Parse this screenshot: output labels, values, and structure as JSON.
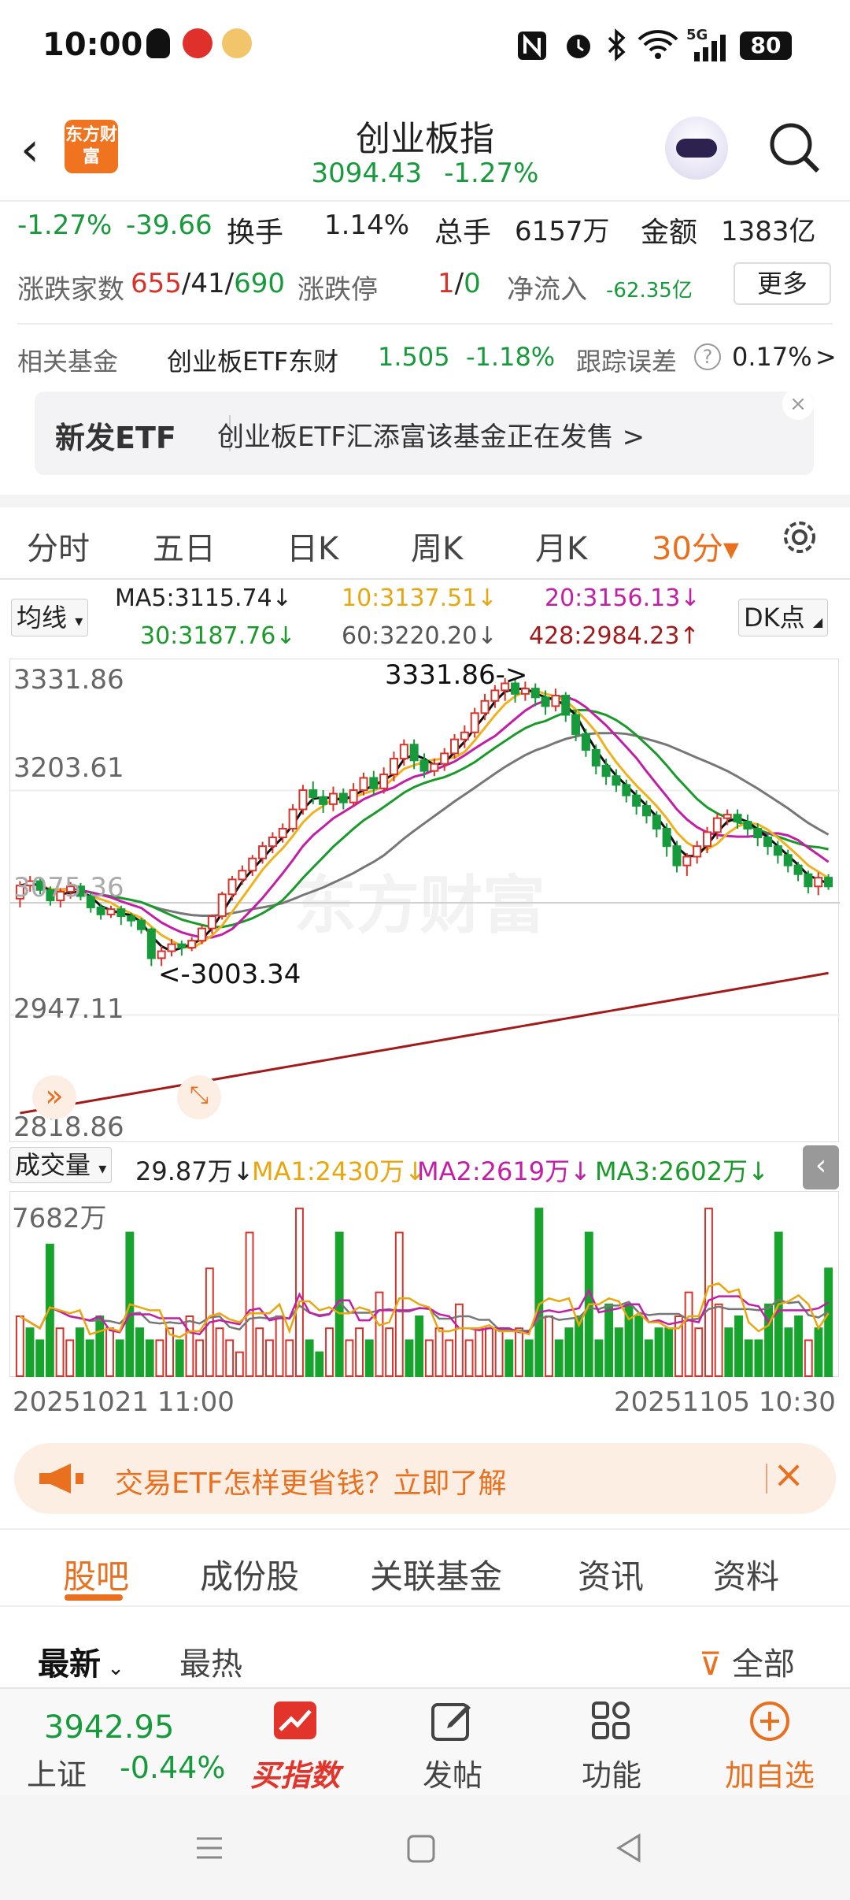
{
  "status_bar": {
    "time": "10:00",
    "battery": "80",
    "network": "5G"
  },
  "header": {
    "logo_text": "东方财富",
    "title": "创业板指",
    "price": "3094.43",
    "change_pct": "-1.27%"
  },
  "stats": {
    "pct": "-1.27%",
    "change": "-39.66",
    "turnover_label": "换手",
    "turnover": "1.14%",
    "volume_label": "总手",
    "volume": "6157万",
    "amount_label": "金额",
    "amount": "1383亿",
    "breadth_label": "涨跌家数",
    "breadth_up": "655",
    "breadth_flat": "41",
    "breadth_down": "690",
    "limit_label": "涨跌停",
    "limit_up": "1",
    "limit_down": "0",
    "netflow_label": "净流入",
    "netflow": "-62.35亿",
    "more": "更多"
  },
  "fund": {
    "label": "相关基金",
    "name": "创业板ETF东财",
    "price": "1.505",
    "pct": "-1.18%",
    "err_label": "跟踪误差",
    "err": "0.17%",
    "arrow": ">"
  },
  "banner": {
    "tag": "新发ETF",
    "text": "创业板ETF汇添富该基金正在发售  >",
    "close": "×"
  },
  "period_tabs": [
    "分时",
    "五日",
    "日K",
    "周K",
    "月K",
    "30分▾"
  ],
  "ma": {
    "selector": "均线",
    "ma5": "MA5:3115.74↓",
    "ma10": "10:3137.51↓",
    "ma20": "20:3156.13↓",
    "ma30": "30:3187.76↓",
    "ma60": "60:3220.20↓",
    "ma428": "428:2984.23↑",
    "dk": "DK点"
  },
  "price_axis": [
    "3331.86",
    "3203.61",
    "3075.36",
    "2947.11",
    "2818.86"
  ],
  "annotations": {
    "high": "3331.86->",
    "low": "<-3003.34",
    "watermark": "东方财富"
  },
  "volume": {
    "selector": "成交量",
    "value": "29.87万↓",
    "ma1": "MA1:2430万↓",
    "ma2": "MA2:2619万↓",
    "ma3": "MA3:2602万↓",
    "axis_max": "7682万"
  },
  "dates": {
    "start": "20251021 11:00",
    "end": "20251105 10:30"
  },
  "notice": {
    "text": "交易ETF怎样更省钱？立即了解",
    "close": "×"
  },
  "content_tabs": [
    "股吧",
    "成份股",
    "关联基金",
    "资讯",
    "资料"
  ],
  "sort": {
    "latest": "最新",
    "hot": "最热",
    "filter": "全部"
  },
  "bottom": {
    "index_price": "3942.95",
    "index_name": "上证",
    "index_pct": "-0.44%",
    "buy": "买指数",
    "post": "发帖",
    "func": "功能",
    "add": "加自选"
  },
  "colors": {
    "up": "#d8332b",
    "down": "#179a3c",
    "accent": "#e8701e",
    "ma5": "#111111",
    "ma10": "#f0b21c",
    "ma20": "#c21ea6",
    "ma30": "#1a9a2a",
    "ma60": "#777777",
    "ma428": "#a31a1a"
  },
  "chart_data": {
    "type": "candlestick",
    "ylim": [
      2818.86,
      3331.86
    ],
    "x_start": "20251021 11:00",
    "x_end": "20251105 10:30",
    "candles": [
      [
        3080,
        3095,
        3070,
        3100
      ],
      [
        3095,
        3100,
        3088,
        3106
      ],
      [
        3100,
        3090,
        3085,
        3104
      ],
      [
        3090,
        3078,
        3072,
        3094
      ],
      [
        3078,
        3088,
        3070,
        3092
      ],
      [
        3088,
        3094,
        3080,
        3099
      ],
      [
        3094,
        3083,
        3078,
        3098
      ],
      [
        3083,
        3070,
        3064,
        3088
      ],
      [
        3070,
        3062,
        3056,
        3074
      ],
      [
        3062,
        3068,
        3058,
        3072
      ],
      [
        3068,
        3060,
        3050,
        3072
      ],
      [
        3060,
        3055,
        3048,
        3064
      ],
      [
        3055,
        3045,
        3040,
        3058
      ],
      [
        3045,
        3012,
        3003,
        3047
      ],
      [
        3012,
        3020,
        3003,
        3026
      ],
      [
        3020,
        3028,
        3014,
        3034
      ],
      [
        3028,
        3024,
        3015,
        3032
      ],
      [
        3024,
        3032,
        3020,
        3036
      ],
      [
        3032,
        3046,
        3028,
        3050
      ],
      [
        3046,
        3060,
        3040,
        3062
      ],
      [
        3060,
        3085,
        3056,
        3088
      ],
      [
        3085,
        3102,
        3078,
        3106
      ],
      [
        3102,
        3112,
        3096,
        3118
      ],
      [
        3112,
        3126,
        3106,
        3130
      ],
      [
        3126,
        3140,
        3120,
        3145
      ],
      [
        3140,
        3150,
        3132,
        3156
      ],
      [
        3150,
        3160,
        3144,
        3166
      ],
      [
        3160,
        3182,
        3156,
        3188
      ],
      [
        3182,
        3204,
        3176,
        3210
      ],
      [
        3204,
        3196,
        3188,
        3214
      ],
      [
        3196,
        3188,
        3178,
        3204
      ],
      [
        3188,
        3200,
        3180,
        3208
      ],
      [
        3200,
        3190,
        3182,
        3206
      ],
      [
        3190,
        3204,
        3186,
        3212
      ],
      [
        3204,
        3218,
        3198,
        3224
      ],
      [
        3218,
        3206,
        3198,
        3226
      ],
      [
        3206,
        3222,
        3200,
        3230
      ],
      [
        3222,
        3240,
        3214,
        3248
      ],
      [
        3240,
        3256,
        3232,
        3262
      ],
      [
        3256,
        3238,
        3228,
        3262
      ],
      [
        3238,
        3226,
        3218,
        3246
      ],
      [
        3226,
        3234,
        3220,
        3240
      ],
      [
        3234,
        3246,
        3226,
        3252
      ],
      [
        3246,
        3262,
        3240,
        3268
      ],
      [
        3262,
        3270,
        3252,
        3278
      ],
      [
        3270,
        3292,
        3264,
        3298
      ],
      [
        3292,
        3306,
        3284,
        3314
      ],
      [
        3306,
        3318,
        3298,
        3324
      ],
      [
        3318,
        3326,
        3306,
        3332
      ],
      [
        3326,
        3314,
        3304,
        3331
      ],
      [
        3314,
        3320,
        3306,
        3328
      ],
      [
        3320,
        3310,
        3300,
        3326
      ],
      [
        3310,
        3300,
        3290,
        3318
      ],
      [
        3300,
        3312,
        3294,
        3320
      ],
      [
        3312,
        3290,
        3282,
        3316
      ],
      [
        3290,
        3268,
        3260,
        3296
      ],
      [
        3268,
        3250,
        3242,
        3274
      ],
      [
        3250,
        3232,
        3222,
        3256
      ],
      [
        3232,
        3220,
        3210,
        3240
      ],
      [
        3220,
        3210,
        3202,
        3228
      ],
      [
        3210,
        3198,
        3190,
        3216
      ],
      [
        3198,
        3186,
        3176,
        3204
      ],
      [
        3186,
        3175,
        3166,
        3192
      ],
      [
        3175,
        3160,
        3150,
        3180
      ],
      [
        3160,
        3140,
        3128,
        3166
      ],
      [
        3140,
        3118,
        3110,
        3146
      ],
      [
        3118,
        3128,
        3106,
        3132
      ],
      [
        3128,
        3140,
        3120,
        3146
      ],
      [
        3140,
        3156,
        3132,
        3162
      ],
      [
        3156,
        3172,
        3148,
        3178
      ],
      [
        3172,
        3176,
        3164,
        3182
      ],
      [
        3176,
        3168,
        3160,
        3182
      ],
      [
        3168,
        3160,
        3152,
        3176
      ],
      [
        3160,
        3150,
        3140,
        3166
      ],
      [
        3150,
        3140,
        3130,
        3156
      ],
      [
        3140,
        3130,
        3120,
        3146
      ],
      [
        3130,
        3118,
        3110,
        3136
      ],
      [
        3118,
        3108,
        3100,
        3122
      ],
      [
        3108,
        3094,
        3086,
        3112
      ],
      [
        3094,
        3104,
        3084,
        3110
      ],
      [
        3104,
        3094,
        3090,
        3108
      ]
    ],
    "volumes": [
      5,
      4,
      3,
      11,
      4,
      3,
      4,
      3,
      5,
      4,
      3,
      12,
      4,
      3,
      3,
      4,
      3,
      5,
      3,
      9,
      4,
      3,
      2,
      12,
      4,
      3,
      5,
      3,
      14,
      3,
      2,
      4,
      12,
      3,
      4,
      3,
      7,
      4,
      12,
      3,
      5,
      3,
      4,
      3,
      6,
      3,
      4,
      4,
      4,
      3,
      4,
      3,
      14,
      5,
      3,
      4,
      5,
      12,
      3,
      6,
      4,
      6,
      5,
      3,
      4,
      4,
      5,
      7,
      4,
      14,
      6,
      4,
      5,
      3,
      3,
      6,
      12,
      4,
      5,
      3,
      4,
      9
    ],
    "volume_up": [
      1,
      0,
      0,
      0,
      1,
      1,
      0,
      0,
      0,
      1,
      0,
      0,
      0,
      0,
      1,
      1,
      0,
      1,
      1,
      1,
      1,
      1,
      1,
      1,
      1,
      1,
      1,
      1,
      1,
      0,
      0,
      1,
      0,
      1,
      1,
      0,
      1,
      1,
      1,
      0,
      0,
      1,
      1,
      1,
      1,
      1,
      1,
      1,
      1,
      0,
      1,
      0,
      0,
      1,
      0,
      0,
      0,
      0,
      0,
      0,
      0,
      0,
      0,
      0,
      0,
      0,
      1,
      1,
      1,
      1,
      1,
      0,
      0,
      0,
      0,
      0,
      0,
      0,
      0,
      1,
      0,
      0
    ]
  }
}
